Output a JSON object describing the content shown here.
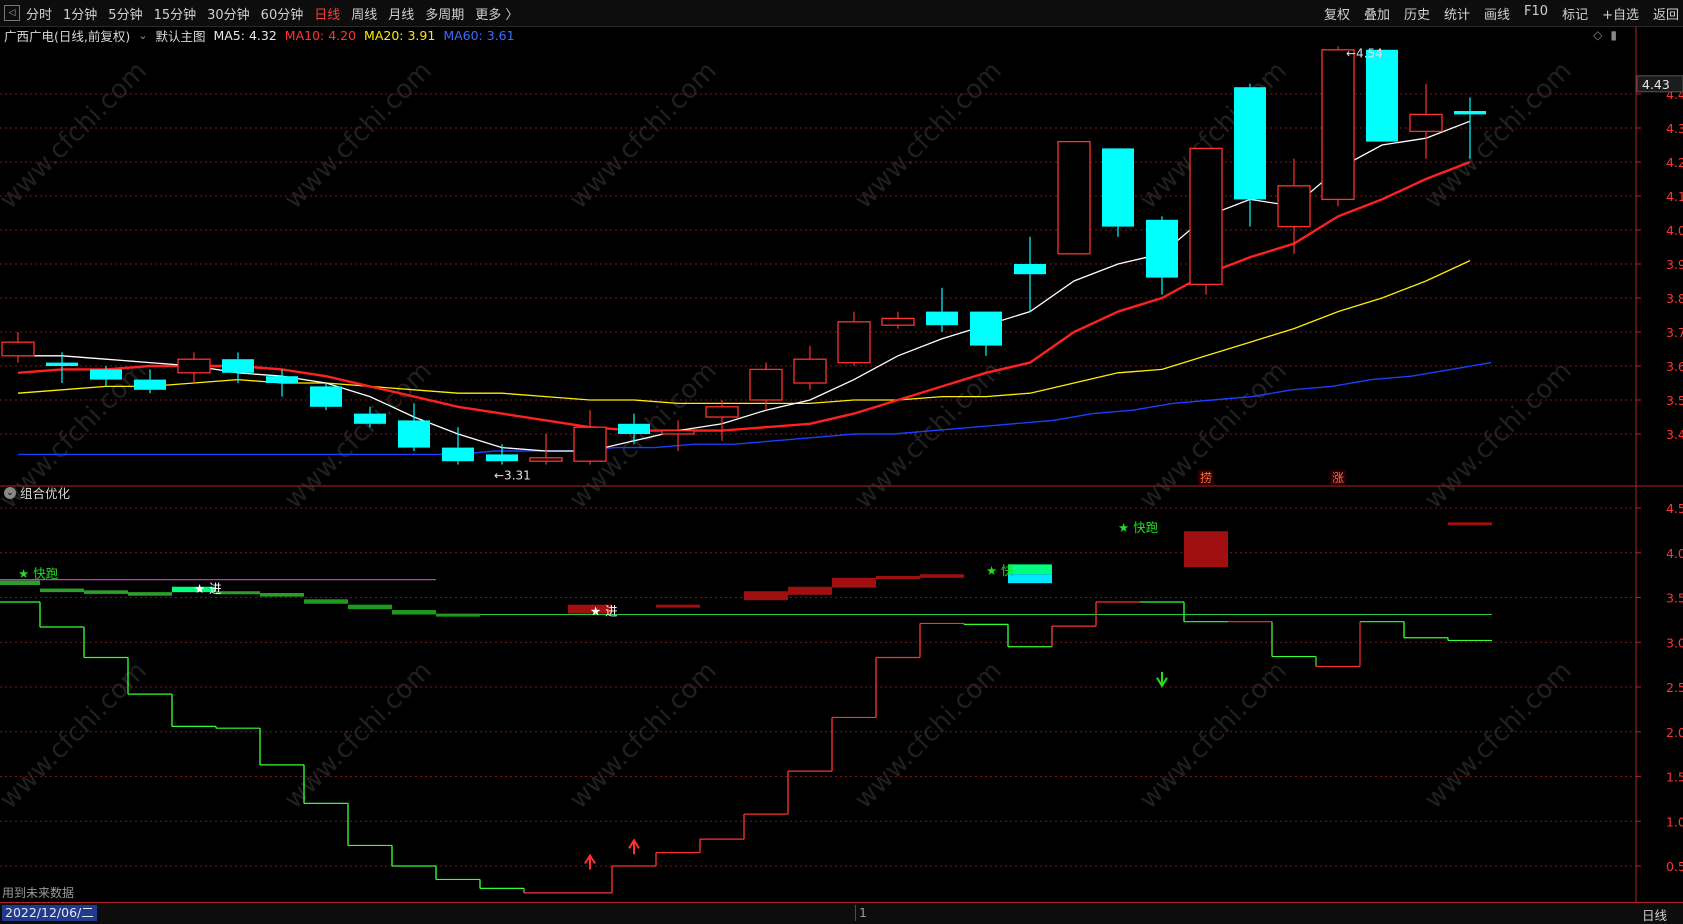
{
  "toolbar": {
    "timeframes": [
      "分时",
      "1分钟",
      "5分钟",
      "15分钟",
      "30分钟",
      "60分钟",
      "日线",
      "周线",
      "月线",
      "多周期",
      "更多 〉"
    ],
    "active_timeframe": "日线",
    "right_tools": [
      "复权",
      "叠加",
      "历史",
      "统计",
      "画线",
      "F10",
      "标记",
      "+自选",
      "返回"
    ]
  },
  "info_line": {
    "stock": "广西广电(日线,前复权)",
    "main_chart": "默认主图",
    "ma5": "MA5: 4.32",
    "ma10": "MA10: 4.20",
    "ma20": "MA20: 3.91",
    "ma60": "MA60: 3.61"
  },
  "indicator": {
    "label": "组合优化"
  },
  "footnote": "用到未来数据",
  "bottom_bar": {
    "date": "2022/12/06/二",
    "mid_marker": "1",
    "period": "日线"
  },
  "watermark": "www.cfchi.com",
  "colors": {
    "up": "#ff3030",
    "down": "#00ffff",
    "ma5": "#ffffff",
    "ma10": "#ff2020",
    "ma20": "#ffee00",
    "ma60": "#1a3fff",
    "grid": "#7a1a1a",
    "axis": "#b0202a"
  },
  "chart_data": [
    {
      "type": "candlestick",
      "yticks": [
        3.4,
        3.5,
        3.6,
        3.7,
        3.8,
        3.9,
        4.0,
        4.1,
        4.2,
        4.3,
        4.4
      ],
      "ylim": [
        3.28,
        4.56
      ],
      "last_price_label": "4.43",
      "candles": [
        {
          "o": 3.63,
          "c": 3.67,
          "h": 3.7,
          "l": 3.61
        },
        {
          "o": 3.61,
          "c": 3.6,
          "h": 3.64,
          "l": 3.55
        },
        {
          "o": 3.59,
          "c": 3.56,
          "h": 3.6,
          "l": 3.54
        },
        {
          "o": 3.56,
          "c": 3.53,
          "h": 3.59,
          "l": 3.52
        },
        {
          "o": 3.58,
          "c": 3.62,
          "h": 3.64,
          "l": 3.55
        },
        {
          "o": 3.62,
          "c": 3.58,
          "h": 3.64,
          "l": 3.55
        },
        {
          "o": 3.57,
          "c": 3.55,
          "h": 3.59,
          "l": 3.51
        },
        {
          "o": 3.54,
          "c": 3.48,
          "h": 3.55,
          "l": 3.47
        },
        {
          "o": 3.46,
          "c": 3.43,
          "h": 3.48,
          "l": 3.42
        },
        {
          "o": 3.44,
          "c": 3.36,
          "h": 3.49,
          "l": 3.35
        },
        {
          "o": 3.36,
          "c": 3.32,
          "h": 3.42,
          "l": 3.31
        },
        {
          "o": 3.34,
          "c": 3.32,
          "h": 3.37,
          "l": 3.31
        },
        {
          "o": 3.32,
          "c": 3.33,
          "h": 3.4,
          "l": 3.31
        },
        {
          "o": 3.32,
          "c": 3.42,
          "h": 3.47,
          "l": 3.31
        },
        {
          "o": 3.43,
          "c": 3.4,
          "h": 3.46,
          "l": 3.37
        },
        {
          "o": 3.4,
          "c": 3.41,
          "h": 3.44,
          "l": 3.35
        },
        {
          "o": 3.45,
          "c": 3.48,
          "h": 3.5,
          "l": 3.38
        },
        {
          "o": 3.5,
          "c": 3.59,
          "h": 3.61,
          "l": 3.47
        },
        {
          "o": 3.55,
          "c": 3.62,
          "h": 3.66,
          "l": 3.53
        },
        {
          "o": 3.61,
          "c": 3.73,
          "h": 3.76,
          "l": 3.6
        },
        {
          "o": 3.72,
          "c": 3.74,
          "h": 3.76,
          "l": 3.71
        },
        {
          "o": 3.76,
          "c": 3.72,
          "h": 3.83,
          "l": 3.7
        },
        {
          "o": 3.76,
          "c": 3.66,
          "h": 3.76,
          "l": 3.63
        },
        {
          "o": 3.9,
          "c": 3.87,
          "h": 3.98,
          "l": 3.76
        },
        {
          "o": 3.93,
          "c": 4.26,
          "h": 4.26,
          "l": 3.93
        },
        {
          "o": 4.24,
          "c": 4.01,
          "h": 4.24,
          "l": 3.98
        },
        {
          "o": 4.03,
          "c": 3.86,
          "h": 4.04,
          "l": 3.81
        },
        {
          "o": 3.84,
          "c": 4.24,
          "h": 4.24,
          "l": 3.81
        },
        {
          "o": 4.42,
          "c": 4.09,
          "h": 4.43,
          "l": 4.01
        },
        {
          "o": 4.01,
          "c": 4.13,
          "h": 4.21,
          "l": 3.93
        },
        {
          "o": 4.09,
          "c": 4.53,
          "h": 4.54,
          "l": 4.07
        },
        {
          "o": 4.53,
          "c": 4.26,
          "h": 4.53,
          "l": 4.26
        },
        {
          "o": 4.29,
          "c": 4.34,
          "h": 4.43,
          "l": 4.21
        },
        {
          "o": 4.35,
          "c": 4.34,
          "h": 4.39,
          "l": 4.21
        }
      ],
      "ma5": [
        3.63,
        3.63,
        3.62,
        3.61,
        3.6,
        3.58,
        3.57,
        3.55,
        3.51,
        3.45,
        3.4,
        3.36,
        3.35,
        3.35,
        3.38,
        3.41,
        3.43,
        3.47,
        3.5,
        3.56,
        3.63,
        3.68,
        3.72,
        3.76,
        3.85,
        3.9,
        3.93,
        4.04,
        4.09,
        4.07,
        4.18,
        4.25,
        4.27,
        4.32
      ],
      "ma10": [
        3.58,
        3.59,
        3.59,
        3.6,
        3.6,
        3.6,
        3.59,
        3.57,
        3.54,
        3.51,
        3.48,
        3.46,
        3.44,
        3.42,
        3.41,
        3.41,
        3.41,
        3.42,
        3.43,
        3.46,
        3.5,
        3.54,
        3.58,
        3.61,
        3.7,
        3.76,
        3.8,
        3.87,
        3.92,
        3.96,
        4.04,
        4.09,
        4.15,
        4.2
      ],
      "ma20": [
        3.52,
        3.53,
        3.54,
        3.54,
        3.55,
        3.56,
        3.55,
        3.55,
        3.54,
        3.53,
        3.52,
        3.52,
        3.51,
        3.5,
        3.5,
        3.49,
        3.49,
        3.49,
        3.49,
        3.5,
        3.5,
        3.51,
        3.51,
        3.52,
        3.55,
        3.58,
        3.59,
        3.63,
        3.67,
        3.71,
        3.76,
        3.8,
        3.85,
        3.91
      ],
      "ma60": [
        3.34,
        3.34,
        3.34,
        3.34,
        3.34,
        3.34,
        3.34,
        3.34,
        3.34,
        3.34,
        3.34,
        3.34,
        3.35,
        3.35,
        3.35,
        3.36,
        3.36,
        3.37,
        3.37,
        3.38,
        3.39,
        3.4,
        3.4,
        3.41,
        3.42,
        3.43,
        3.44,
        3.46,
        3.47,
        3.49,
        3.5,
        3.51,
        3.53,
        3.54,
        3.56,
        3.57,
        3.59,
        3.61
      ],
      "annotations": [
        {
          "index": 11,
          "text": "←3.31",
          "price": 3.31,
          "pos": "below"
        },
        {
          "index": 30,
          "text": "←4.54",
          "price": 4.54,
          "pos": "right"
        },
        {
          "index": 27,
          "text": "捞",
          "pos": "bottom"
        },
        {
          "index": 30,
          "text": "涨",
          "pos": "bottom"
        }
      ]
    },
    {
      "type": "step",
      "title": "组合优化",
      "yticks": [
        0.5,
        1.0,
        1.5,
        2.0,
        2.5,
        3.0,
        3.5,
        4.0,
        4.5
      ],
      "ylim": [
        0.05,
        4.75
      ],
      "step_values": [
        3.45,
        3.17,
        2.83,
        2.42,
        2.06,
        2.04,
        1.63,
        1.2,
        0.73,
        0.5,
        0.35,
        0.25,
        0.2,
        0.2,
        0.5,
        0.65,
        0.8,
        1.08,
        1.56,
        2.16,
        2.83,
        3.21,
        3.2,
        2.95,
        3.18,
        3.45,
        3.45,
        3.23,
        3.23,
        2.84,
        2.73,
        3.23,
        3.05,
        3.02
      ],
      "step_colors": [
        "g",
        "g",
        "g",
        "g",
        "g",
        "g",
        "g",
        "g",
        "g",
        "g",
        "g",
        "g",
        "r",
        "r",
        "r",
        "r",
        "r",
        "r",
        "r",
        "r",
        "r",
        "r",
        "g",
        "g",
        "r",
        "r",
        "g",
        "g",
        "r",
        "g",
        "r",
        "g",
        "g",
        "g"
      ],
      "baseline_value": 3.31,
      "magenta_line": {
        "value": 3.7,
        "from": 0,
        "to": 9
      },
      "signal_bars": [
        {
          "index": 0,
          "top": 3.69,
          "bottom": 3.64,
          "color": "#2aa02a"
        },
        {
          "index": 1,
          "top": 3.6,
          "bottom": 3.56,
          "color": "#2aa02a"
        },
        {
          "index": 2,
          "top": 3.58,
          "bottom": 3.54,
          "color": "#2aa02a"
        },
        {
          "index": 3,
          "top": 3.56,
          "bottom": 3.52,
          "color": "#2aa02a"
        },
        {
          "index": 5,
          "top": 3.57,
          "bottom": 3.54,
          "color": "#2aa02a"
        },
        {
          "index": 6,
          "top": 3.55,
          "bottom": 3.51,
          "color": "#2aa02a"
        },
        {
          "index": 7,
          "top": 3.48,
          "bottom": 3.43,
          "color": "#1f9a1f"
        },
        {
          "index": 8,
          "top": 3.42,
          "bottom": 3.37,
          "color": "#1f9a1f"
        },
        {
          "index": 9,
          "top": 3.36,
          "bottom": 3.31,
          "color": "#1f9a1f"
        },
        {
          "index": 10,
          "top": 3.32,
          "bottom": 3.3,
          "color": "#1f9a1f"
        },
        {
          "index": 13,
          "top": 3.42,
          "bottom": 3.32,
          "color": "#a01010"
        },
        {
          "index": 15,
          "top": 3.42,
          "bottom": 3.4,
          "color": "#a01010"
        },
        {
          "index": 17,
          "top": 3.57,
          "bottom": 3.47,
          "color": "#a01010"
        },
        {
          "index": 18,
          "top": 3.62,
          "bottom": 3.53,
          "color": "#a01010"
        },
        {
          "index": 19,
          "top": 3.72,
          "bottom": 3.61,
          "color": "#a01010"
        },
        {
          "index": 20,
          "top": 3.74,
          "bottom": 3.72,
          "color": "#a01010"
        },
        {
          "index": 21,
          "top": 3.76,
          "bottom": 3.72,
          "color": "#a01010"
        },
        {
          "index": 27,
          "top": 4.24,
          "bottom": 3.84,
          "color": "#a01010"
        },
        {
          "index": 33,
          "top": 4.34,
          "bottom": 4.32,
          "color": "#a01010"
        }
      ],
      "highlight_boxes": [
        {
          "index": 4,
          "top": 3.62,
          "bottom": 3.56,
          "color": "#00ff7f"
        },
        {
          "index": 23,
          "top": 3.87,
          "bottom": 3.76,
          "color": "#00ff7f"
        },
        {
          "index": 23,
          "top": 3.76,
          "bottom": 3.66,
          "color": "#00e8ff"
        }
      ],
      "labels": [
        {
          "index": 0,
          "value": 3.72,
          "text": "★ 快跑",
          "color": "#22dd22"
        },
        {
          "index": 4,
          "value": 3.55,
          "text": "★ 进",
          "color": "#ffffff"
        },
        {
          "index": 13,
          "value": 3.3,
          "text": "★ 进",
          "color": "#ffffff"
        },
        {
          "index": 22,
          "value": 3.75,
          "text": "★ 快",
          "color": "#22dd22"
        },
        {
          "index": 25,
          "value": 4.23,
          "text": "★ 快跑",
          "color": "#22dd22"
        }
      ],
      "arrows": [
        {
          "index": 13,
          "value": 0.55,
          "dir": "up",
          "color": "#ff3030"
        },
        {
          "index": 14,
          "value": 0.72,
          "dir": "up",
          "color": "#ff3030"
        },
        {
          "index": 26,
          "value": 2.58,
          "dir": "down",
          "color": "#22dd22"
        }
      ]
    }
  ]
}
